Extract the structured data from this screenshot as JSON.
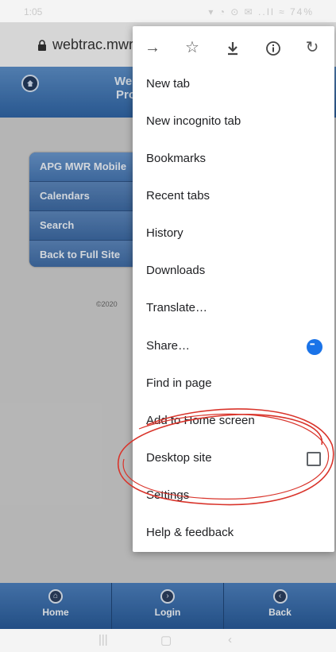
{
  "status_bar": {
    "time": "1:05",
    "icons": "▾ ◔ ⊙ ✉ ..Il ≈ 74%"
  },
  "address_bar": {
    "url": "webtrac.mwr."
  },
  "site": {
    "title_line1": "We",
    "title_line2": "Pro",
    "nav_items": [
      "APG MWR Mobile",
      "Calendars",
      "Search",
      "Back to Full Site"
    ],
    "copyright": "©2020"
  },
  "footer": {
    "buttons": [
      {
        "label": "Home",
        "icon": "home-icon"
      },
      {
        "label": "Login",
        "icon": "login-icon"
      },
      {
        "label": "Back",
        "icon": "back-icon"
      }
    ]
  },
  "menu": {
    "top_icons": [
      "forward-arrow-icon",
      "star-icon",
      "download-icon",
      "info-icon",
      "refresh-icon"
    ],
    "items": [
      {
        "label": "New tab"
      },
      {
        "label": "New incognito tab"
      },
      {
        "label": "Bookmarks"
      },
      {
        "label": "Recent tabs"
      },
      {
        "label": "History"
      },
      {
        "label": "Downloads"
      },
      {
        "label": "Translate…"
      },
      {
        "label": "Share…"
      },
      {
        "label": "Find in page"
      },
      {
        "label": "Add to Home screen"
      },
      {
        "label": "Desktop site",
        "checked": false
      },
      {
        "label": "Settings"
      },
      {
        "label": "Help & feedback"
      }
    ]
  },
  "colors": {
    "accent": "#1a73e8",
    "annotation": "#d9342b",
    "site_blue": "#3c6aa3"
  }
}
